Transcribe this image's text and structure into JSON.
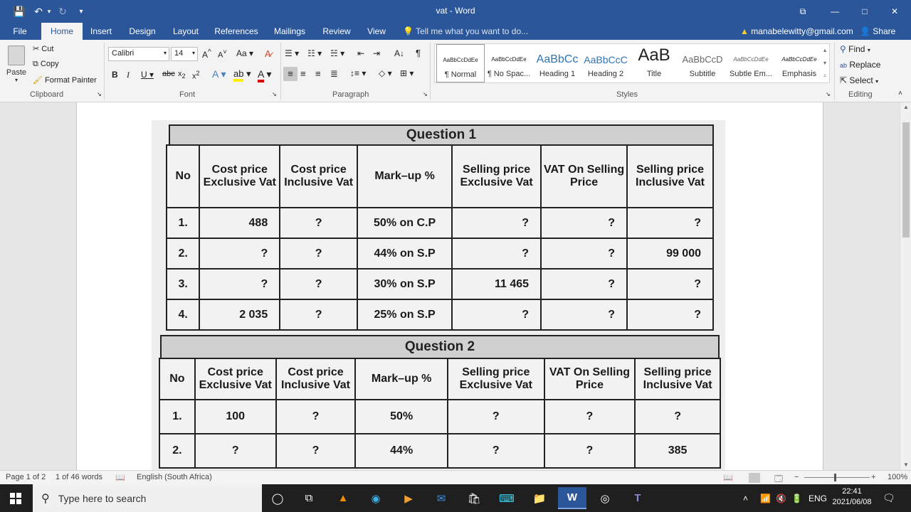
{
  "window": {
    "title": "vat - Word",
    "controls": {
      "restore_ribbon": "⧉",
      "minimize": "—",
      "maximize": "□",
      "close": "✕"
    }
  },
  "quick_access": {
    "save": "💾",
    "undo": "↶",
    "redo": "↻",
    "customize": "▾"
  },
  "tabs": [
    "File",
    "Home",
    "Insert",
    "Design",
    "Layout",
    "References",
    "Mailings",
    "Review",
    "View"
  ],
  "active_tab": "Home",
  "tell_me": "Tell me what you want to do...",
  "account": {
    "email": "manabelewitty@gmail.com",
    "share": "Share"
  },
  "clipboard": {
    "paste": "Paste",
    "cut": "Cut",
    "copy": "Copy",
    "format_painter": "Format Painter",
    "label": "Clipboard"
  },
  "font": {
    "name": "Calibri",
    "size": "14",
    "label": "Font"
  },
  "paragraph": {
    "label": "Paragraph"
  },
  "styles": {
    "label": "Styles",
    "items": [
      {
        "preview": "AaBbCcDdEe",
        "name": "¶ Normal"
      },
      {
        "preview": "AaBbCcDdEe",
        "name": "¶ No Spac..."
      },
      {
        "preview": "AaBbCc",
        "name": "Heading 1"
      },
      {
        "preview": "AaBbCcC",
        "name": "Heading 2"
      },
      {
        "preview": "AaB",
        "name": "Title"
      },
      {
        "preview": "AaBbCcD",
        "name": "Subtitle"
      },
      {
        "preview": "AaBbCcDdEe",
        "name": "Subtle Em..."
      },
      {
        "preview": "AaBbCcDdEe",
        "name": "Emphasis"
      }
    ]
  },
  "editing": {
    "find": "Find",
    "replace": "Replace",
    "select": "Select",
    "label": "Editing"
  },
  "document": {
    "question1": {
      "title": "Question 1",
      "headers": [
        "No",
        "Cost price Exclusive Vat",
        "Cost price Inclusive Vat",
        "Mark–up %",
        "Selling price Exclusive Vat",
        "VAT On Selling Price",
        "Selling price Inclusive Vat"
      ],
      "rows": [
        [
          "1.",
          "488",
          "?",
          "50% on C.P",
          "?",
          "?",
          "?"
        ],
        [
          "2.",
          "?",
          "?",
          "44% on S.P",
          "?",
          "?",
          "99 000"
        ],
        [
          "3.",
          "?",
          "?",
          "30% on S.P",
          "11 465",
          "?",
          "?"
        ],
        [
          "4.",
          "2 035",
          "?",
          "25% on S.P",
          "?",
          "?",
          "?"
        ]
      ]
    },
    "question2": {
      "title": "Question 2",
      "headers": [
        "No",
        "Cost price Exclusive Vat",
        "Cost price Inclusive Vat",
        "Mark–up %",
        "Selling price Exclusive Vat",
        "VAT On Selling Price",
        "Selling price Inclusive Vat"
      ],
      "rows": [
        [
          "1.",
          "100",
          "?",
          "50%",
          "?",
          "?",
          "?"
        ],
        [
          "2.",
          "?",
          "?",
          "44%",
          "?",
          "?",
          "385"
        ]
      ]
    }
  },
  "status": {
    "page": "Page 1 of 2",
    "words": "1 of 46 words",
    "language": "English (South Africa)",
    "zoom": "100%"
  },
  "taskbar": {
    "search_placeholder": "Type here to search",
    "tray_lang": "ENG",
    "time": "22:41",
    "date": "2021/06/08"
  }
}
